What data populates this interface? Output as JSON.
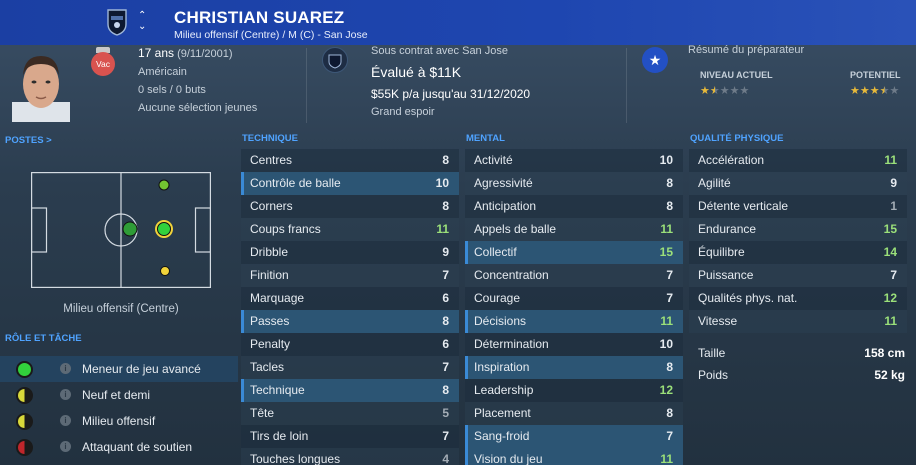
{
  "header": {
    "name": "CHRISTIAN SUAREZ",
    "position": "Milieu offensif (Centre) / M (C) - San Jose"
  },
  "profile": {
    "age": "17 ans",
    "dob": "(9/11/2001)",
    "nationality": "Américain",
    "caps": "0 sels / 0 buts",
    "youth": "Aucune sélection jeunes",
    "status_badge": "Vac"
  },
  "contract": {
    "status": "Sous contrat avec San Jose",
    "value": "Évalué à $11K",
    "wage": "$55K p/a jusqu'au 31/12/2020",
    "tag": "Grand espoir"
  },
  "scout": {
    "title": "Résumé du préparateur",
    "current_label": "NIVEAU ACTUEL",
    "potential_label": "POTENTIEL",
    "current_stars": 1.5,
    "potential_stars": 3.5
  },
  "positions": {
    "title": "POSTES >",
    "label": "Milieu offensif (Centre)"
  },
  "roles": {
    "title": "RÔLE ET TÂCHE",
    "items": [
      {
        "label": "Meneur de jeu avancé",
        "color": "#32d13c"
      },
      {
        "label": "Neuf et demi",
        "color": "#d8d83a"
      },
      {
        "label": "Milieu offensif",
        "color": "#d8d83a"
      },
      {
        "label": "Attaquant de soutien",
        "color": "#c0262b"
      }
    ]
  },
  "technique": {
    "title": "TECHNIQUE",
    "rows": [
      {
        "name": "Centres",
        "value": "8"
      },
      {
        "name": "Contrôle de balle",
        "value": "10",
        "hl": true
      },
      {
        "name": "Corners",
        "value": "8"
      },
      {
        "name": "Coups francs",
        "value": "11"
      },
      {
        "name": "Dribble",
        "value": "9"
      },
      {
        "name": "Finition",
        "value": "7"
      },
      {
        "name": "Marquage",
        "value": "6"
      },
      {
        "name": "Passes",
        "value": "8",
        "hl": true
      },
      {
        "name": "Penalty",
        "value": "6"
      },
      {
        "name": "Tacles",
        "value": "7"
      },
      {
        "name": "Technique",
        "value": "8",
        "hl": true
      },
      {
        "name": "Tête",
        "value": "5"
      },
      {
        "name": "Tirs de loin",
        "value": "7"
      },
      {
        "name": "Touches longues",
        "value": "4"
      }
    ]
  },
  "mental": {
    "title": "MENTAL",
    "rows": [
      {
        "name": "Activité",
        "value": "10"
      },
      {
        "name": "Agressivité",
        "value": "8"
      },
      {
        "name": "Anticipation",
        "value": "8"
      },
      {
        "name": "Appels de balle",
        "value": "11"
      },
      {
        "name": "Collectif",
        "value": "15",
        "hl": true
      },
      {
        "name": "Concentration",
        "value": "7"
      },
      {
        "name": "Courage",
        "value": "7"
      },
      {
        "name": "Décisions",
        "value": "11",
        "hl": true
      },
      {
        "name": "Détermination",
        "value": "10"
      },
      {
        "name": "Inspiration",
        "value": "8",
        "hl": true
      },
      {
        "name": "Leadership",
        "value": "12"
      },
      {
        "name": "Placement",
        "value": "8"
      },
      {
        "name": "Sang-froid",
        "value": "7",
        "hl": true
      },
      {
        "name": "Vision du jeu",
        "value": "11",
        "hl": true
      }
    ]
  },
  "physical": {
    "title": "QUALITÉ PHYSIQUE",
    "rows": [
      {
        "name": "Accélération",
        "value": "11"
      },
      {
        "name": "Agilité",
        "value": "9"
      },
      {
        "name": "Détente verticale",
        "value": "1"
      },
      {
        "name": "Endurance",
        "value": "15"
      },
      {
        "name": "Équilibre",
        "value": "14"
      },
      {
        "name": "Puissance",
        "value": "7"
      },
      {
        "name": "Qualités phys. nat.",
        "value": "12"
      },
      {
        "name": "Vitesse",
        "value": "11"
      }
    ],
    "height_label": "Taille",
    "height_value": "158 cm",
    "weight_label": "Poids",
    "weight_value": "52 kg"
  }
}
